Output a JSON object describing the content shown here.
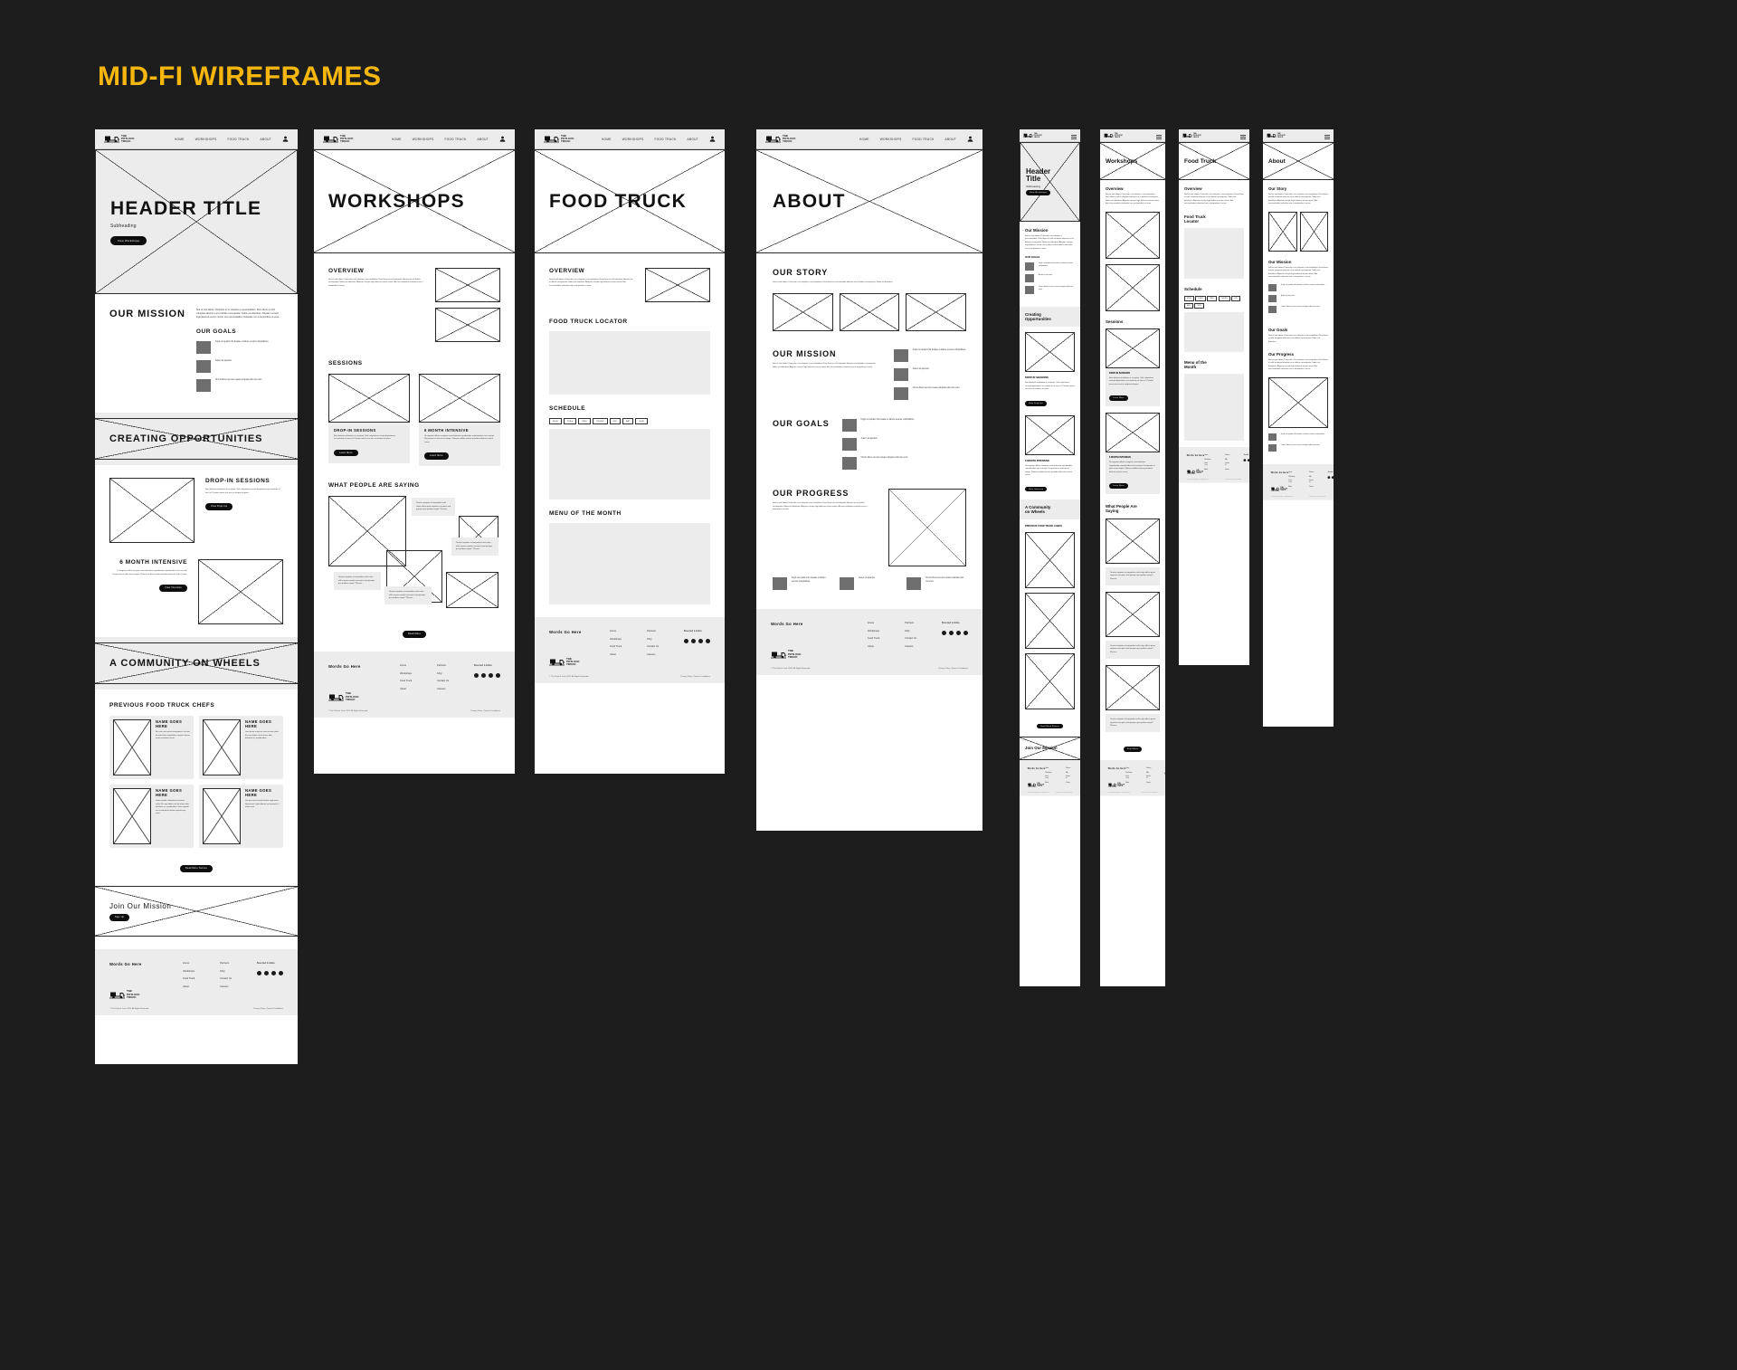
{
  "board": {
    "title": "MID-FI WIREFRAMES",
    "accent_color": "#f5b60d",
    "background_color": "#1d1d1d"
  },
  "brand": {
    "name_line1": "THE",
    "name_line2": "POTLUCK",
    "name_line3": "TRUCK",
    "logo_icon": "food-truck-icon"
  },
  "nav": {
    "items": [
      "HOME",
      "WORKSHOPS",
      "FOOD TRUCK",
      "ABOUT"
    ],
    "account_icon": "user-account-icon"
  },
  "lorem": {
    "p1": "Sed sit sint labore. Distinctio et et voluptas a necessitatibus. Rem libero et nihil voluptate laborum est et debitis consequatur. Nobis est doloribus. Aliquam corrupti fugit delectus eorum omnis. Aut necessitatibus molestias non a temporibus ut esse.",
    "p2": "Illum dolorem molestias ut accepturi. Velit voluptatem corrupti dignissimos accusantium sit eius sit. Pariatur omnis eius eos ut voluptas id quasi.",
    "p3": "Ut magnam officiis excepturi exercitationem repudiandae reprehenderit eius corrupti. Perspiciatis et odio minus itaque. Ratione mollitia veniam provident delectus sed et rerum.",
    "p4": "Nam dolores molestias ut accepturi. Velit voluptatem corrupti dignissimos accusantium sit eius sit. Placeat omnia eius eos ut voluptas id quasi.",
    "p5": "Sed sit sint labore. Distinctio et et voluptas a necessitatibus. Rem libero et nihil voluptate laborum est et debitis consequatur. Nobis est doloribus.",
    "goal1": "Fugit est quidem illo beatae et labore eveniet voluptatibus.",
    "goal2": "Autem at aperiam.",
    "goal3": "Omnis libero aut sint usuaa voluptas odio nisi enim.",
    "chef1": "Est earn vero amet consequatur. Isso est ita molestiae voluptatibus corporis harum omnis provident rerum.",
    "chef2": "Isaio beum or qui tas vero minima nobis. Et cona debitis ut ab autem odio doloribus eu repudiandae.",
    "chef3": "Unde impedit voluptatem inventore nobis. Et cona debitis vel ab autem odio doloribus eu repudiandae. Esse impedit non commodi et ratione aperiam qui enim.",
    "chef4": "Iste quo sunt eveniet beatae aspernatur laboriosam culpa dolores swa quaerat ut nobis nosa.",
    "quote1": "Tenetur sapiente et temporibus velit culpa officia quasi sapiente excepturi sed quiaque quo quidem eaque? Placeat.",
    "quote2": "Tenetur sapiente et temporibus velit culpa officia quasi sapiente excepturi sed quiaque quo quidem eaque? Placeat.",
    "quote3": "Tenetur sapiente et temporibus velit culpa officia quasi sapiente excepturi sed quiaque quo quidem eaque? Placeat."
  },
  "desktop_home": {
    "hero_title": "HEADER TITLE",
    "hero_subheading": "Subheading",
    "hero_cta": "View Workshops",
    "s_mission": "OUR MISSION",
    "s_goals": "OUR GOALS",
    "s_creating": "CREATING OPPORTUNITIES",
    "s_dropin": "DROP-IN SESSIONS",
    "dropin_cta": "View Drop-Ins",
    "s_intensive": "6 MONTH INTENSIVE",
    "intensive_cta": "View Intensive",
    "s_community": "A COMMUNITY ON WHEELS",
    "s_chefs": "PREVIOUS FOOD TRUCK CHEFS",
    "chef_name": "NAME GOES HERE",
    "chefs_cta": "Read More Stories",
    "s_join": "Join Our Mission",
    "join_cta": "Sign Up"
  },
  "desktop_workshops": {
    "hero_title": "WORKSHOPS",
    "s_overview": "OVERVIEW",
    "s_sessions": "SESSIONS",
    "card1_title": "DROP-IN SESSIONS",
    "card2_title": "6 MONTH INTENSIVE",
    "card_cta": "Learn More",
    "s_saying": "WHAT PEOPLE ARE SAYING",
    "saying_cta": "Read More"
  },
  "desktop_foodtruck": {
    "hero_title": "FOOD TRUCK",
    "s_overview": "OVERVIEW",
    "s_locator": "FOOD TRUCK LOCATOR",
    "s_schedule": "SCHEDULE",
    "days": [
      "MON",
      "TUES",
      "WED",
      "THURS",
      "FRI",
      "SAT",
      "SUN"
    ],
    "s_menu": "MENU OF THE MONTH"
  },
  "desktop_about": {
    "hero_title": "ABOUT",
    "s_story": "OUR STORY",
    "s_mission": "OUR MISSION",
    "s_goals": "OUR GOALS",
    "s_progress": "OUR PROGRESS"
  },
  "mobile_home": {
    "hero_title_l1": "Header",
    "hero_title_l2": "Title",
    "hero_subheading": "Subheading",
    "hero_cta": "View Workshops",
    "s_mission": "Our Mission",
    "s_goals": "OUR GOALS",
    "s_creating_l1": "Creating",
    "s_creating_l2": "Opportunities",
    "s_dropin": "DROP-IN SESSIONS",
    "dropin_cta": "View Drop-Ins",
    "s_intensive": "6 MONTH INTENSIVE",
    "intensive_cta": "View Intensive",
    "s_community_l1": "A Community",
    "s_community_l2": "on Wheels",
    "s_chefs": "PREVIOUS FOOD TRUCK CHEFS",
    "chefs_cta": "Read More Stories",
    "s_join": "Join Our Mission"
  },
  "mobile_workshops": {
    "hero_title": "Workshops",
    "s_overview": "Overview",
    "s_sessions": "Sessions",
    "card1_title": "DROP-IN SESSIONS",
    "card2_title": "6 MONTH INTENSIVE",
    "card_cta": "Learn More",
    "s_saying_l1": "What People Are",
    "s_saying_l2": "Saying",
    "saying_cta": "Read More"
  },
  "mobile_foodtruck": {
    "hero_title": "Food Truck",
    "s_overview": "Overview",
    "s_locator_l1": "Food Truck",
    "s_locator_l2": "Locator",
    "s_schedule": "Schedule",
    "days": [
      "MON",
      "TUES",
      "WED",
      "THURS",
      "FRI",
      "SAT",
      "SUN"
    ],
    "s_menu_l1": "Menu of the",
    "s_menu_l2": "Month"
  },
  "mobile_about": {
    "hero_title": "About",
    "s_story": "Our Story",
    "s_mission": "Our Mission",
    "s_goals": "Our Goals",
    "s_progress": "Our Progress"
  },
  "footer": {
    "words": "Words Go Here",
    "col1": [
      "Home",
      "Workshops",
      "Food Truck",
      "About"
    ],
    "col2": [
      "Partners",
      "FAQ",
      "Contact Us",
      "Careers"
    ],
    "social_label": "Social Links",
    "social_icons": [
      "facebook-icon",
      "twitter-icon",
      "instagram-icon",
      "youtube-icon"
    ],
    "copyright": "© The Potluck Truck 2025. All Rights Reserved.",
    "policy": "Privacy Policy | Terms & Conditions"
  }
}
